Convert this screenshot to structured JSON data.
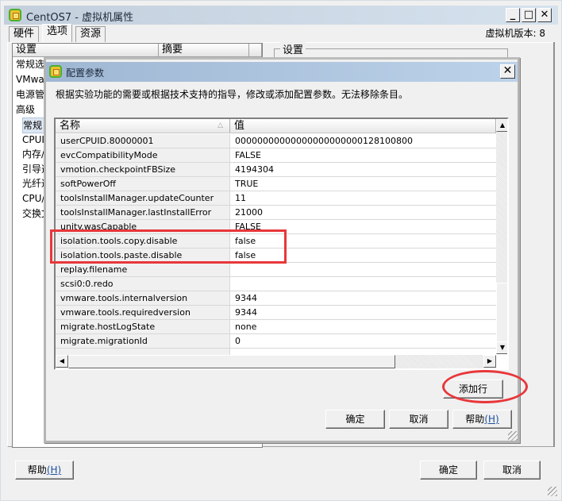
{
  "window": {
    "title": "CentOS7 - 虚拟机属性",
    "minimize_label": "_",
    "maximize_label": "□",
    "close_label": "✕",
    "version_label": "虚拟机版本: 8",
    "tabs": [
      {
        "label": "硬件",
        "active": false
      },
      {
        "label": "选项",
        "active": true
      },
      {
        "label": "资源",
        "active": false
      }
    ],
    "settings_list": {
      "headers": [
        "设置",
        "摘要"
      ],
      "items": [
        {
          "label": "常规选项",
          "indent": false,
          "selected": false
        },
        {
          "label": "VMware Tools",
          "indent": false,
          "selected": false
        },
        {
          "label": "电源管理",
          "indent": false,
          "selected": false
        },
        {
          "label": "高级",
          "indent": false,
          "selected": false
        },
        {
          "label": "常规",
          "indent": true,
          "selected": true
        },
        {
          "label": "CPUID 掩码",
          "indent": true,
          "selected": false
        },
        {
          "label": "内存/CPU 热插拔",
          "indent": true,
          "selected": false
        },
        {
          "label": "引导选项",
          "indent": true,
          "selected": false
        },
        {
          "label": "光纤通道 NPIV",
          "indent": true,
          "selected": false
        },
        {
          "label": "CPU/MMU 虚拟化",
          "indent": true,
          "selected": false
        },
        {
          "label": "交换文件位置",
          "indent": true,
          "selected": false
        }
      ]
    },
    "settings_group_label": "设置",
    "help_button": "帮助",
    "help_hotkey": "(H)",
    "ok_button": "确定",
    "cancel_button": "取消"
  },
  "dialog": {
    "title": "配置参数",
    "close_label": "✕",
    "description": "根据实验功能的需要或根据技术支持的指导，修改或添加配置参数。无法移除条目。",
    "table": {
      "columns": [
        {
          "label": "名称",
          "sort": "ascending"
        },
        {
          "label": "值"
        }
      ],
      "rows": [
        {
          "name": "userCPUID.80000001",
          "value": "00000000000000000000000128100800"
        },
        {
          "name": "evcCompatibilityMode",
          "value": "FALSE"
        },
        {
          "name": "vmotion.checkpointFBSize",
          "value": "4194304"
        },
        {
          "name": "softPowerOff",
          "value": "TRUE"
        },
        {
          "name": "toolsInstallManager.updateCounter",
          "value": "11"
        },
        {
          "name": "toolsInstallManager.lastInstallError",
          "value": "21000"
        },
        {
          "name": "unity.wasCapable",
          "value": "FALSE"
        },
        {
          "name": "isolation.tools.copy.disable",
          "value": "false",
          "highlighted": true
        },
        {
          "name": "isolation.tools.paste.disable",
          "value": "false",
          "highlighted": true
        },
        {
          "name": "replay.filename",
          "value": ""
        },
        {
          "name": "scsi0:0.redo",
          "value": ""
        },
        {
          "name": "vmware.tools.internalversion",
          "value": "9344"
        },
        {
          "name": "vmware.tools.requiredversion",
          "value": "9344"
        },
        {
          "name": "migrate.hostLogState",
          "value": "none"
        },
        {
          "name": "migrate.migrationId",
          "value": "0"
        }
      ],
      "vertical_scroll_position": "bottom"
    },
    "add_row_button": "添加行",
    "ok_button": "确定",
    "cancel_button": "取消",
    "help_button": "帮助",
    "help_hotkey": "(H)"
  },
  "annotations": {
    "color": "#e8373a"
  }
}
